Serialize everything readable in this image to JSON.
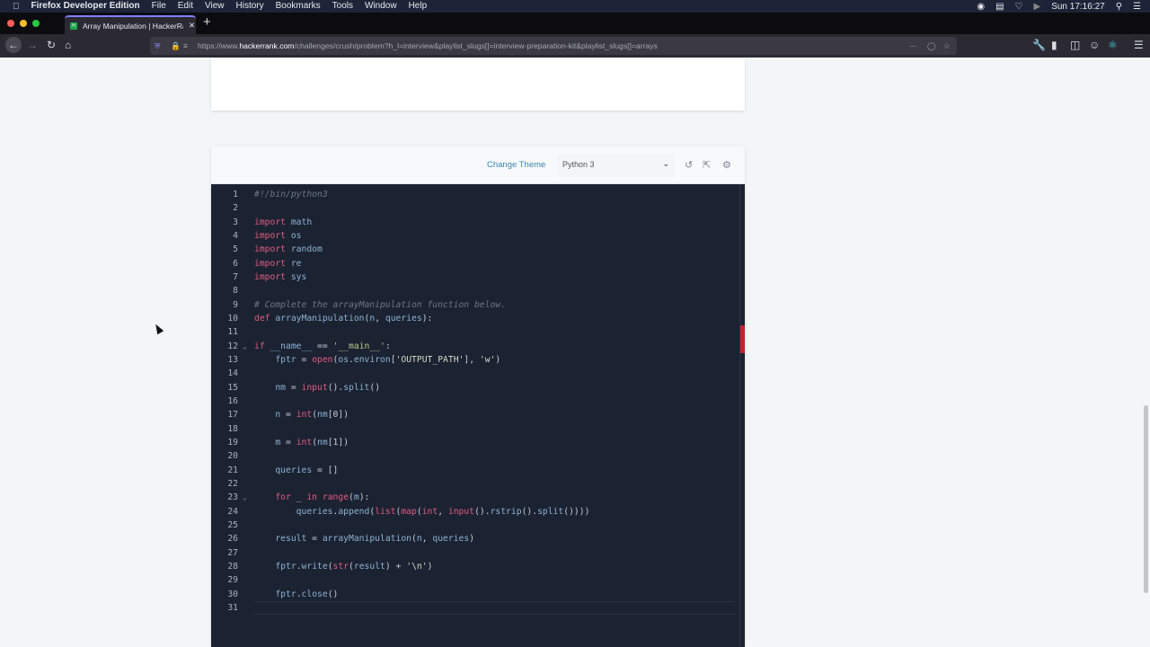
{
  "menubar": {
    "app_name": "Firefox Developer Edition",
    "items": [
      "File",
      "Edit",
      "View",
      "History",
      "Bookmarks",
      "Tools",
      "Window",
      "Help"
    ],
    "clock": "Sun 17:16:27"
  },
  "browser": {
    "tab_title": "Array Manipulation | HackerRank",
    "url_prefix": "https://www.",
    "url_domain": "hackerrank.com",
    "url_path": "/challenges/crush/problem?h_l=interview&playlist_slugs[]=interview-preparation-kit&playlist_slugs[]=arrays"
  },
  "editor": {
    "change_theme_label": "Change Theme",
    "language": "Python 3",
    "colors": {
      "background": "#1b2231",
      "keyword": "#e25c80",
      "identifier": "#8cb3d6",
      "comment": "#6d7889"
    },
    "lines": [
      {
        "n": "1",
        "fold": false,
        "tokens": [
          [
            "c",
            "#!/bin/python3"
          ]
        ]
      },
      {
        "n": "2",
        "fold": false,
        "tokens": []
      },
      {
        "n": "3",
        "fold": false,
        "tokens": [
          [
            "k",
            "import"
          ],
          [
            "p",
            " "
          ],
          [
            "v",
            "math"
          ]
        ]
      },
      {
        "n": "4",
        "fold": false,
        "tokens": [
          [
            "k",
            "import"
          ],
          [
            "p",
            " "
          ],
          [
            "v",
            "os"
          ]
        ]
      },
      {
        "n": "5",
        "fold": false,
        "tokens": [
          [
            "k",
            "import"
          ],
          [
            "p",
            " "
          ],
          [
            "v",
            "random"
          ]
        ]
      },
      {
        "n": "6",
        "fold": false,
        "tokens": [
          [
            "k",
            "import"
          ],
          [
            "p",
            " "
          ],
          [
            "v",
            "re"
          ]
        ]
      },
      {
        "n": "7",
        "fold": false,
        "tokens": [
          [
            "k",
            "import"
          ],
          [
            "p",
            " "
          ],
          [
            "v",
            "sys"
          ]
        ]
      },
      {
        "n": "8",
        "fold": false,
        "tokens": []
      },
      {
        "n": "9",
        "fold": false,
        "tokens": [
          [
            "c",
            "# Complete the arrayManipulation function below."
          ]
        ]
      },
      {
        "n": "10",
        "fold": false,
        "tokens": [
          [
            "k",
            "def"
          ],
          [
            "p",
            " "
          ],
          [
            "v",
            "arrayManipulation"
          ],
          [
            "p",
            "("
          ],
          [
            "v",
            "n"
          ],
          [
            "p",
            ", "
          ],
          [
            "v",
            "queries"
          ],
          [
            "p",
            "):"
          ]
        ]
      },
      {
        "n": "11",
        "fold": false,
        "tokens": []
      },
      {
        "n": "12",
        "fold": true,
        "tokens": [
          [
            "k",
            "if"
          ],
          [
            "p",
            " "
          ],
          [
            "v",
            "__name__"
          ],
          [
            "p",
            " == "
          ],
          [
            "g",
            "'__main__'"
          ],
          [
            "p",
            ":"
          ]
        ]
      },
      {
        "n": "13",
        "fold": false,
        "tokens": [
          [
            "p",
            "    "
          ],
          [
            "v",
            "fptr"
          ],
          [
            "p",
            " = "
          ],
          [
            "k",
            "open"
          ],
          [
            "p",
            "("
          ],
          [
            "v",
            "os"
          ],
          [
            "p",
            "."
          ],
          [
            "v",
            "environ"
          ],
          [
            "p",
            "["
          ],
          [
            "s",
            "'OUTPUT_PATH'"
          ],
          [
            "p",
            "], "
          ],
          [
            "s",
            "'w'"
          ],
          [
            "p",
            ")"
          ]
        ]
      },
      {
        "n": "14",
        "fold": false,
        "tokens": []
      },
      {
        "n": "15",
        "fold": false,
        "tokens": [
          [
            "p",
            "    "
          ],
          [
            "v",
            "nm"
          ],
          [
            "p",
            " = "
          ],
          [
            "k",
            "input"
          ],
          [
            "p",
            "()."
          ],
          [
            "v",
            "split"
          ],
          [
            "p",
            "()"
          ]
        ]
      },
      {
        "n": "16",
        "fold": false,
        "tokens": []
      },
      {
        "n": "17",
        "fold": false,
        "tokens": [
          [
            "p",
            "    "
          ],
          [
            "v",
            "n"
          ],
          [
            "p",
            " = "
          ],
          [
            "k",
            "int"
          ],
          [
            "p",
            "("
          ],
          [
            "v",
            "nm"
          ],
          [
            "p",
            "[0])"
          ]
        ]
      },
      {
        "n": "18",
        "fold": false,
        "tokens": []
      },
      {
        "n": "19",
        "fold": false,
        "tokens": [
          [
            "p",
            "    "
          ],
          [
            "v",
            "m"
          ],
          [
            "p",
            " = "
          ],
          [
            "k",
            "int"
          ],
          [
            "p",
            "("
          ],
          [
            "v",
            "nm"
          ],
          [
            "p",
            "[1])"
          ]
        ]
      },
      {
        "n": "20",
        "fold": false,
        "tokens": []
      },
      {
        "n": "21",
        "fold": false,
        "tokens": [
          [
            "p",
            "    "
          ],
          [
            "v",
            "queries"
          ],
          [
            "p",
            " = []"
          ]
        ]
      },
      {
        "n": "22",
        "fold": false,
        "tokens": []
      },
      {
        "n": "23",
        "fold": true,
        "tokens": [
          [
            "p",
            "    "
          ],
          [
            "k",
            "for"
          ],
          [
            "p",
            " _ "
          ],
          [
            "k",
            "in"
          ],
          [
            "p",
            " "
          ],
          [
            "k",
            "range"
          ],
          [
            "p",
            "("
          ],
          [
            "v",
            "m"
          ],
          [
            "p",
            "):"
          ]
        ]
      },
      {
        "n": "24",
        "fold": false,
        "tokens": [
          [
            "p",
            "        "
          ],
          [
            "v",
            "queries"
          ],
          [
            "p",
            "."
          ],
          [
            "v",
            "append"
          ],
          [
            "p",
            "("
          ],
          [
            "k",
            "list"
          ],
          [
            "p",
            "("
          ],
          [
            "k",
            "map"
          ],
          [
            "p",
            "("
          ],
          [
            "k",
            "int"
          ],
          [
            "p",
            ", "
          ],
          [
            "k",
            "input"
          ],
          [
            "p",
            "()."
          ],
          [
            "v",
            "rstrip"
          ],
          [
            "p",
            "()."
          ],
          [
            "v",
            "split"
          ],
          [
            "p",
            "())))"
          ]
        ]
      },
      {
        "n": "25",
        "fold": false,
        "tokens": []
      },
      {
        "n": "26",
        "fold": false,
        "tokens": [
          [
            "p",
            "    "
          ],
          [
            "v",
            "result"
          ],
          [
            "p",
            " = "
          ],
          [
            "v",
            "arrayManipulation"
          ],
          [
            "p",
            "("
          ],
          [
            "v",
            "n"
          ],
          [
            "p",
            ", "
          ],
          [
            "v",
            "queries"
          ],
          [
            "p",
            ")"
          ]
        ]
      },
      {
        "n": "27",
        "fold": false,
        "tokens": []
      },
      {
        "n": "28",
        "fold": false,
        "tokens": [
          [
            "p",
            "    "
          ],
          [
            "v",
            "fptr"
          ],
          [
            "p",
            "."
          ],
          [
            "v",
            "write"
          ],
          [
            "p",
            "("
          ],
          [
            "k",
            "str"
          ],
          [
            "p",
            "("
          ],
          [
            "v",
            "result"
          ],
          [
            "p",
            ") + "
          ],
          [
            "s",
            "'\\n'"
          ],
          [
            "p",
            ")"
          ]
        ]
      },
      {
        "n": "29",
        "fold": false,
        "tokens": []
      },
      {
        "n": "30",
        "fold": false,
        "tokens": [
          [
            "p",
            "    "
          ],
          [
            "v",
            "fptr"
          ],
          [
            "p",
            "."
          ],
          [
            "v",
            "close"
          ],
          [
            "p",
            "()"
          ]
        ]
      },
      {
        "n": "31",
        "fold": false,
        "tokens": []
      }
    ]
  }
}
